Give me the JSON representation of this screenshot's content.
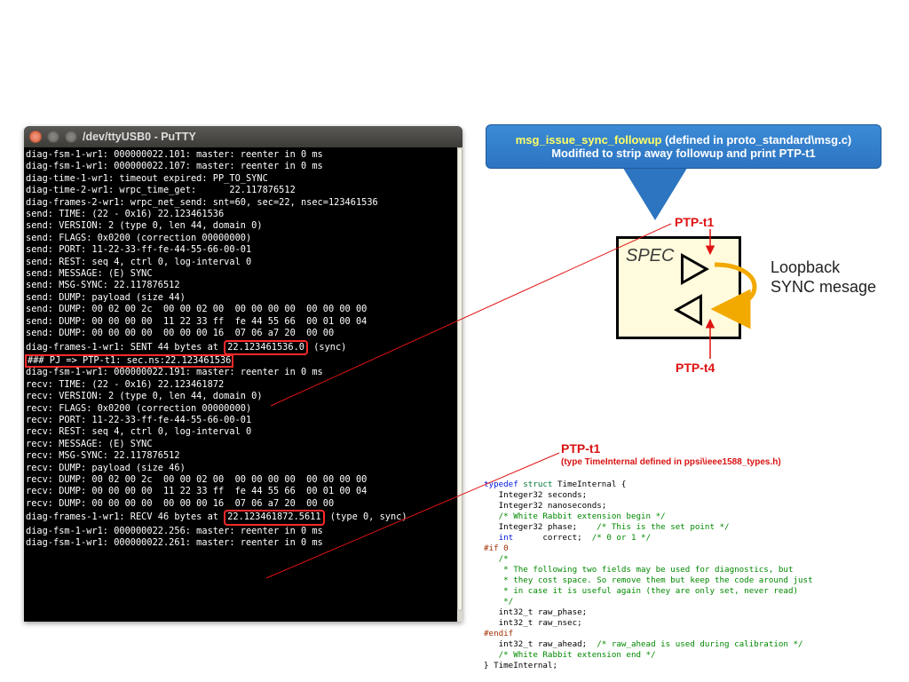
{
  "window": {
    "title": "/dev/ttyUSB0 - PuTTY"
  },
  "terminal": {
    "before": "diag-fsm-1-wr1: 000000022.101: master: reenter in 0 ms\ndiag-fsm-1-wr1: 000000022.107: master: reenter in 0 ms\ndiag-time-1-wr1: timeout expired: PP_TO_SYNC\ndiag-time-2-wr1: wrpc_time_get:      22.117876512\ndiag-frames-2-wr1: wrpc_net_send: snt=60, sec=22, nsec=123461536\nsend: TIME: (22 - 0x16) 22.123461536\nsend: VERSION: 2 (type 0, len 44, domain 0)\nsend: FLAGS: 0x0200 (correction 00000000)\nsend: PORT: 11-22-33-ff-fe-44-55-66-00-01\nsend: REST: seq 4, ctrl 0, log-interval 0\nsend: MESSAGE: (E) SYNC\nsend: MSG-SYNC: 22.117876512\nsend: DUMP: payload (size 44)\nsend: DUMP: 00 02 00 2c  00 00 02 00  00 00 00 00  00 00 00 00\nsend: DUMP: 00 00 00 00  11 22 33 ff  fe 44 55 66  00 01 00 04\nsend: DUMP: 00 00 00 00  00 00 00 16  07 06 a7 20  00 00",
    "sent_a": "diag-frames-1-wr1: SENT 44 bytes at ",
    "sent_ts": "22.123461536.0",
    "sent_b": "(sync)",
    "pjline": "### PJ => PTP-t1: sec.ns:22.123461536",
    "middle": "diag-fsm-1-wr1: 000000022.191: master: reenter in 0 ms\nrecv: TIME: (22 - 0x16) 22.123461872\nrecv: VERSION: 2 (type 0, len 44, domain 0)\nrecv: FLAGS: 0x0200 (correction 00000000)\nrecv: PORT: 11-22-33-ff-fe-44-55-66-00-01\nrecv: REST: seq 4, ctrl 0, log-interval 0\nrecv: MESSAGE: (E) SYNC\nrecv: MSG-SYNC: 22.117876512\nrecv: DUMP: payload (size 46)\nrecv: DUMP: 00 02 00 2c  00 00 02 00  00 00 00 00  00 00 00 00\nrecv: DUMP: 00 00 00 00  11 22 33 ff  fe 44 55 66  00 01 00 04\nrecv: DUMP: 00 00 00 00  00 00 00 16  07 06 a7 20  00 00",
    "recv_a": "diag-frames-1-wr1: RECV 46 bytes at ",
    "recv_ts": "22.123461872.5611",
    "recv_b": "(type 0, sync)",
    "after": "diag-fsm-1-wr1: 000000022.256: master: reenter in 0 ms\ndiag-fsm-1-wr1: 000000022.261: master: reenter in 0 ms"
  },
  "callout": {
    "line1a": "msg_issue_sync_followup",
    "line1b": " (defined in proto_standard\\msg.c)",
    "line2": "Modified to strip away followup and print PTP-t1"
  },
  "labels": {
    "ptp_t1_top": "PTP-t1",
    "ptp_t4": "PTP-t4",
    "spec": "SPEC",
    "loopback": "Loopback\nSYNC mesage",
    "struct_title": "PTP-t1",
    "struct_sub": "(type TimeInternal defined in ppsi\\ieee1588_types.h)"
  },
  "code": {
    "l1a": "typedef",
    "l1b": " struct",
    "l1c": " TimeInternal {",
    "l2": "   Integer32 seconds;",
    "l3": "   Integer32 nanoseconds;",
    "l4": "   /* White Rabbit extension begin */",
    "l5a": "   Integer32 phase;    ",
    "l5b": "/* This is the set point */",
    "l6a": "   int",
    "l6b": "      correct;  ",
    "l6c": "/* 0 or 1 */",
    "l7": "#if 0",
    "l8": "   /*",
    "l9": "    * The following two fields may be used for diagnostics, but",
    "l10": "    * they cost space. So remove them but keep the code around just",
    "l11": "    * in case it is useful again (they are only set, never read)",
    "l12": "    */",
    "l13": "   int32_t raw_phase;",
    "l14": "   int32_t raw_nsec;",
    "l15": "#endif",
    "l16a": "   int32_t raw_ahead;  ",
    "l16b": "/* raw_ahead is used during calibration */",
    "l17": "   /* White Rabbit extension end */",
    "l18": "} TimeInternal;"
  }
}
